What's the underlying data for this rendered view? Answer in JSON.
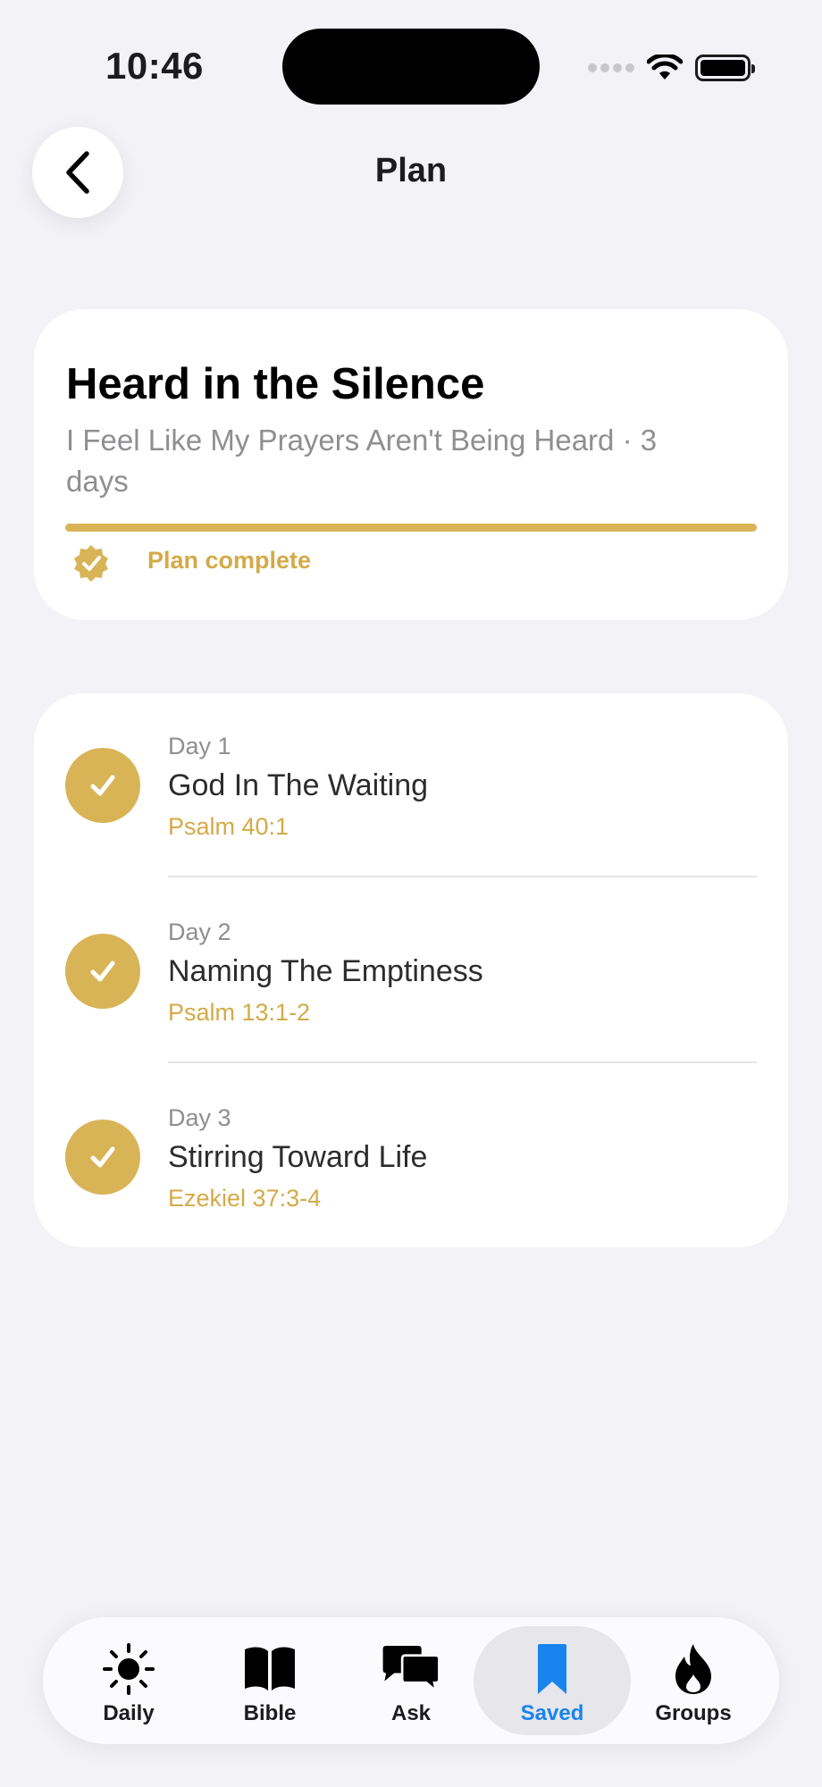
{
  "status_bar": {
    "time": "10:46"
  },
  "header": {
    "title": "Plan"
  },
  "plan": {
    "title": "Heard in the Silence",
    "subtitle": "I Feel Like My Prayers Aren't Being Heard · 3 days",
    "progress": 1.0,
    "status": "Plan complete"
  },
  "days": [
    {
      "label": "Day 1",
      "title": "God In The Waiting",
      "reference": "Psalm 40:1",
      "completed": true
    },
    {
      "label": "Day 2",
      "title": "Naming The Emptiness",
      "reference": "Psalm 13:1-2",
      "completed": true
    },
    {
      "label": "Day 3",
      "title": "Stirring Toward Life",
      "reference": "Ezekiel 37:3-4",
      "completed": true
    }
  ],
  "tabs": [
    {
      "label": "Daily",
      "icon": "sun-icon"
    },
    {
      "label": "Bible",
      "icon": "book-icon"
    },
    {
      "label": "Ask",
      "icon": "chat-bubbles-icon"
    },
    {
      "label": "Saved",
      "icon": "bookmark-icon",
      "active": true
    },
    {
      "label": "Groups",
      "icon": "flame-icon"
    }
  ],
  "colors": {
    "accent_gold": "#d9b457",
    "active_tab_blue": "#1a84ee",
    "background": "#f2f2f7"
  }
}
